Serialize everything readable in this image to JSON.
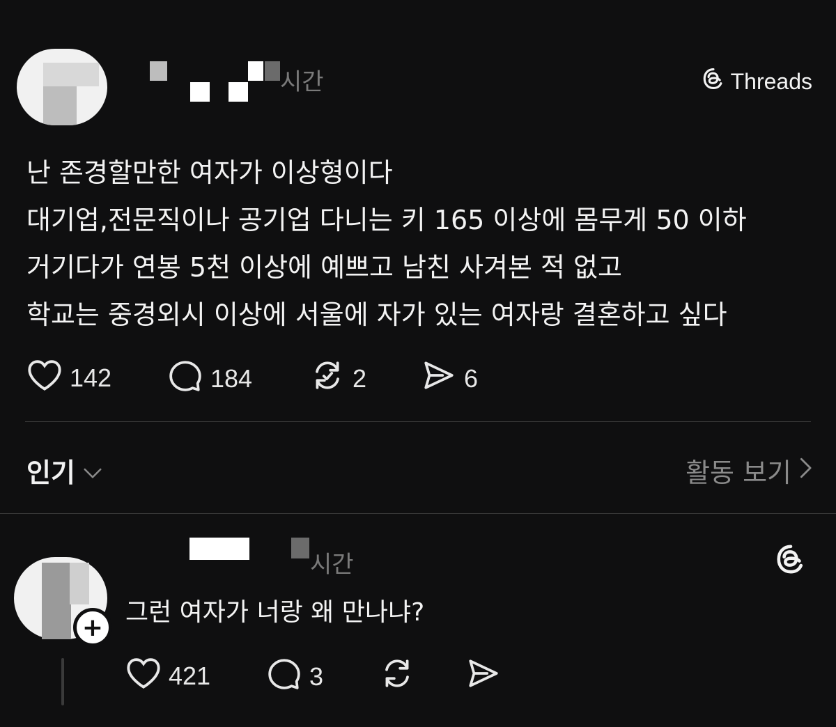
{
  "post": {
    "time_suffix": "시간",
    "brand_label": "Threads",
    "text": "난 존경할만한 여자가 이상형이다\n대기업,전문직이나 공기업 다니는 키 165 이상에 몸무게 50 이하\n거기다가 연봉 5천 이상에 예쁘고 남친 사겨본 적 없고\n학교는 중경외시 이상에 서울에 자가 있는 여자랑 결혼하고 싶다",
    "likes": "142",
    "comments": "184",
    "reposts": "2",
    "shares": "6"
  },
  "replies_header": {
    "sort_label": "인기",
    "activity_label": "활동 보기"
  },
  "reply": {
    "time_suffix": "시간",
    "text": "그런 여자가 너랑 왜 만나냐?",
    "likes": "421",
    "comments": "3"
  },
  "icons": {
    "like": "heart-icon",
    "comment": "comment-icon",
    "repost": "repost-icon",
    "share": "send-icon",
    "brand": "threads-logo-icon",
    "chevron_down": "chevron-down-icon",
    "chevron_right": "chevron-right-icon",
    "follow": "plus-icon"
  },
  "colors": {
    "background": "#0f0f10",
    "text": "#f3f3f3",
    "muted": "#8a8a8a",
    "divider": "#3a3a3a"
  }
}
